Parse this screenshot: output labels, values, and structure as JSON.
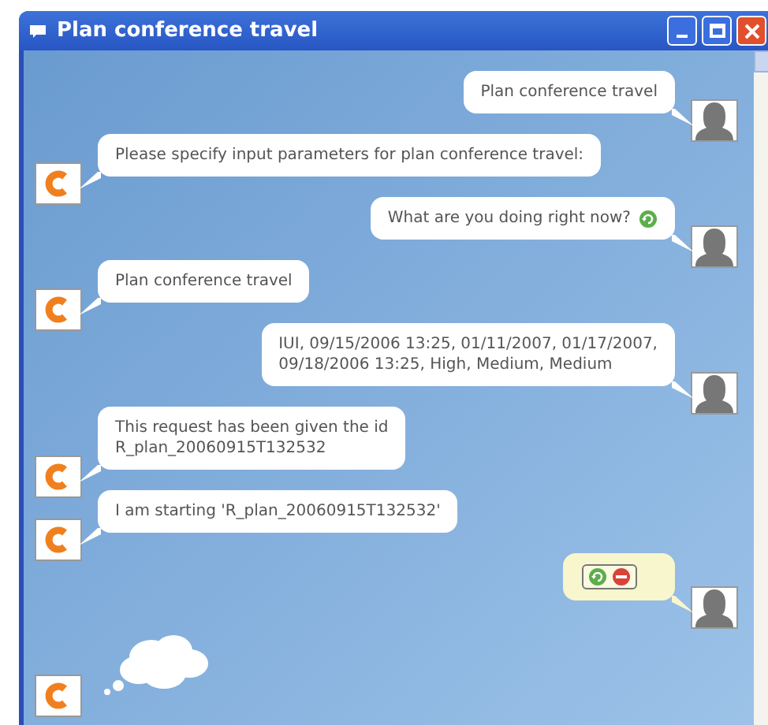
{
  "window": {
    "title": "Plan conference travel"
  },
  "messages": [
    {
      "kind": "user",
      "text": "Plan conference travel"
    },
    {
      "kind": "bot",
      "text": "Please specify input parameters for plan conference travel:"
    },
    {
      "kind": "user-query",
      "text": "What are you doing right now?"
    },
    {
      "kind": "bot",
      "text": "Plan conference travel"
    },
    {
      "kind": "user",
      "text": "IUI, 09/15/2006 13:25, 01/11/2007, 01/17/2007,\n09/18/2006 13:25, High, Medium, Medium"
    },
    {
      "kind": "bot",
      "text": "This request has been given the id\nR_plan_20060915T132532"
    },
    {
      "kind": "bot",
      "text": "I am starting 'R_plan_20060915T132532'"
    },
    {
      "kind": "status"
    },
    {
      "kind": "thinking"
    }
  ]
}
